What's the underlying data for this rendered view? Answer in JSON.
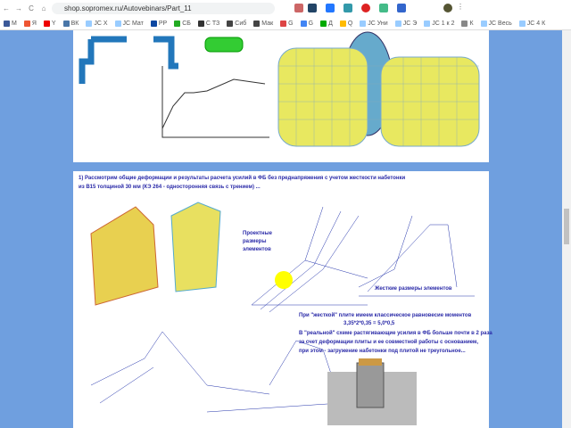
{
  "browser": {
    "url": "shop.sopromex.ru/Autovebinars/Part_11",
    "nav": {
      "back": "←",
      "forward": "→",
      "reload": "C",
      "home": "⌂"
    },
    "bookmarks": [
      {
        "label": "M",
        "color": "#3b5998"
      },
      {
        "label": "Я",
        "color": "#e53"
      },
      {
        "label": "Y",
        "color": "#e00"
      },
      {
        "label": "ВК",
        "color": "#4a76a8"
      },
      {
        "label": "JC Х",
        "color": "#9cf"
      },
      {
        "label": "JC Мат",
        "color": "#9cf"
      },
      {
        "label": "РР",
        "color": "#0d47a1"
      },
      {
        "label": "СБ",
        "color": "#2a2"
      },
      {
        "label": "С ТЗ",
        "color": "#333"
      },
      {
        "label": "Сиб",
        "color": "#444"
      },
      {
        "label": "Мак",
        "color": "#444"
      },
      {
        "label": "G",
        "color": "#d44"
      },
      {
        "label": "G",
        "color": "#4285f4"
      },
      {
        "label": "Д",
        "color": "#0a0"
      },
      {
        "label": "Q",
        "color": "#fb0"
      },
      {
        "label": "JC Уни",
        "color": "#9cf"
      },
      {
        "label": "JC Э",
        "color": "#9cf"
      },
      {
        "label": "JC 1 к 2",
        "color": "#9cf"
      },
      {
        "label": "К",
        "color": "#888"
      },
      {
        "label": "JC Весь",
        "color": "#9cf"
      },
      {
        "label": "JC 4 К",
        "color": "#9cf"
      }
    ]
  },
  "content": {
    "heading": "1) Рассмотрим общие деформации и результаты расчета усилий в ФБ без преднапряжения с учетом жесткости набетонки",
    "heading2": "из В15 толщиной 30 мм (КЭ 264 - односторонняя связь с трением) ...",
    "label_design": "Проектные размеры элементов",
    "label_rigid": "Жесткие размеры элементов",
    "p1": "При \"жесткой\" плите имеем классическое равновесие моментов",
    "p2": "3,35*2*0,35 = 5,0*0,5",
    "p3": "В \"реальной\" схеме растягивающие усилия в ФБ больше почти в 2 раза",
    "p4": "за счет деформации плиты и ее совместной работы с основанием,",
    "p5": "при этом - загружение набетонки под плитой не треугольное..."
  },
  "colors": {
    "page_bg": "#6f9fdf",
    "text": "#2a2aa8",
    "mesh": "#2233aa"
  }
}
